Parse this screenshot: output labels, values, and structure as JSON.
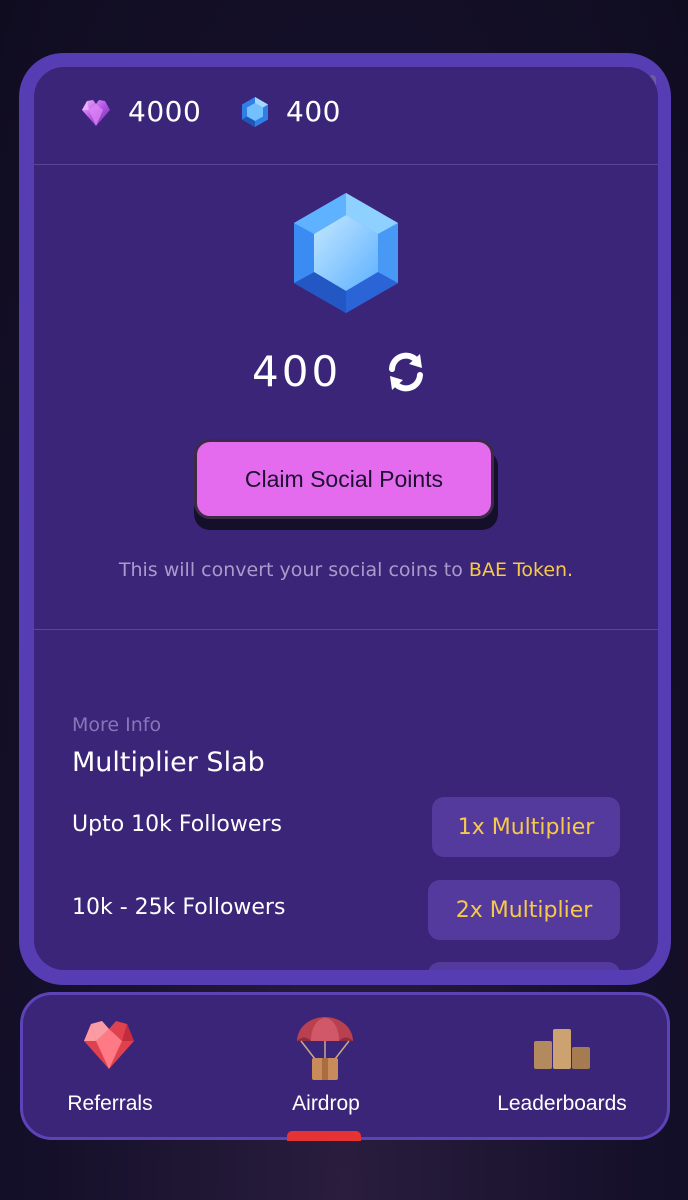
{
  "balances": {
    "hearts": "4000",
    "gems": "400"
  },
  "points": {
    "value": "400"
  },
  "claim": {
    "button_label": "Claim Social Points",
    "note_prefix": "This will convert your social coins to ",
    "note_highlight": "BAE Token."
  },
  "info": {
    "more_info_label": "More Info",
    "slab_title": "Multiplier Slab",
    "rows": [
      {
        "label": "Upto 10k Followers",
        "multiplier": "1x Multiplier"
      },
      {
        "label": "10k - 25k Followers",
        "multiplier": "2x Multiplier"
      },
      {
        "label": "",
        "multiplier": ""
      }
    ]
  },
  "nav": {
    "items": [
      {
        "label": "Referrals",
        "icon": "heart-gem-icon"
      },
      {
        "label": "Airdrop",
        "icon": "parachute-icon",
        "active": true
      },
      {
        "label": "Leaderboards",
        "icon": "podium-icon"
      }
    ]
  },
  "colors": {
    "card_bg": "#3b2578",
    "card_border": "#573db4",
    "button_pink": "#e46bed",
    "highlight_gold": "#f6c94a",
    "active_indicator": "#e53333"
  }
}
